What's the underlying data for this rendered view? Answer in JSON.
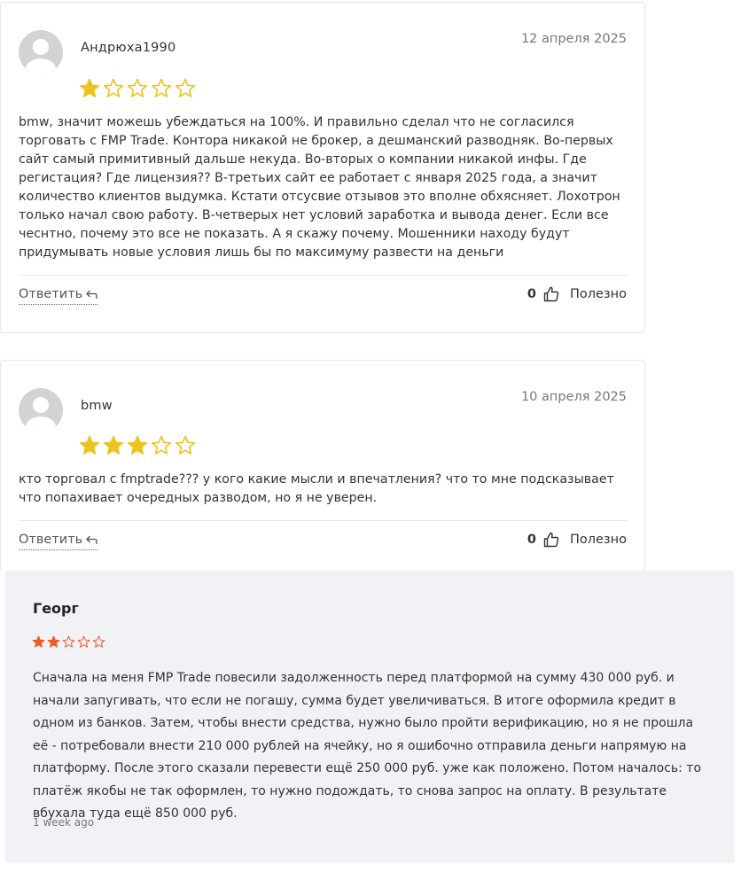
{
  "reviews": [
    {
      "author": "Андрюха1990",
      "date": "12 апреля 2025",
      "rating": 1,
      "max_rating": 5,
      "text": "bmw, значит можешь убеждаться на 100%. И правильно сделал что не согласился торговать с FMP Trade. Контора никакой не брокер, а дешманский разводняк. Во-первых сайт самый примитивный дальше некуда. Во-вторых о компании никакой инфы. Где регистация? Где лицензия?? В-третьих сайт ее работает с января 2025 года, а значит количество клиентов выдумка. Кстати отсусвие отзывов это вполне обхясняет. Лохотрон только начал свою работу. В-четверых нет условий заработка и вывода денег. Если все чеснтно, почему это все не показать. А я скажу почему. Мошенники находу будут придумывать новые условия лишь бы по максимуму развести на деньги",
      "reply_label": "Ответить",
      "votes": "0",
      "useful_label": "Полезно"
    },
    {
      "author": "bmw",
      "date": "10 апреля 2025",
      "rating": 3,
      "max_rating": 5,
      "text": "кто торговал с fmptrade??? у кого какие мысли и впечатления? что то мне подсказывает что попахивает очередных разводом, но я не уверен.",
      "reply_label": "Ответить",
      "votes": "0",
      "useful_label": "Полезно"
    }
  ],
  "third_review": {
    "author": "Георг",
    "rating": 2,
    "max_rating": 5,
    "text": "Сначала на меня FMP Trade повесили задолженность перед платформой на сумму 430 000 руб. и начали запугивать, что если не погашу, сумма будет увеличиваться. В итоге оформила кредит в одном из банков. Затем, чтобы внести средства, нужно было пройти верификацию, но я не прошла её - потребовали внести 210 000 рублей на ячейку, но я ошибочно отправила деньги напрямую на платформу. После этого сказали перевести ещё 250 000 руб. уже как положено. Потом началось: то платёж якобы не так оформлен, то нужно подождать, то снова запрос на оплату. В результате вбухала туда ещё 850 000 руб.",
    "time": "1 week ago"
  },
  "colors": {
    "star_yellow": "#ecc31f",
    "star_orange": "#f05a28",
    "third_bg": "#f1f2f6"
  },
  "icons": {
    "avatar": "avatar-placeholder-icon",
    "star_filled": "star-filled-icon",
    "star_empty": "star-outline-icon",
    "reply": "reply-arrow-icon",
    "thumb": "thumbs-up-icon"
  }
}
